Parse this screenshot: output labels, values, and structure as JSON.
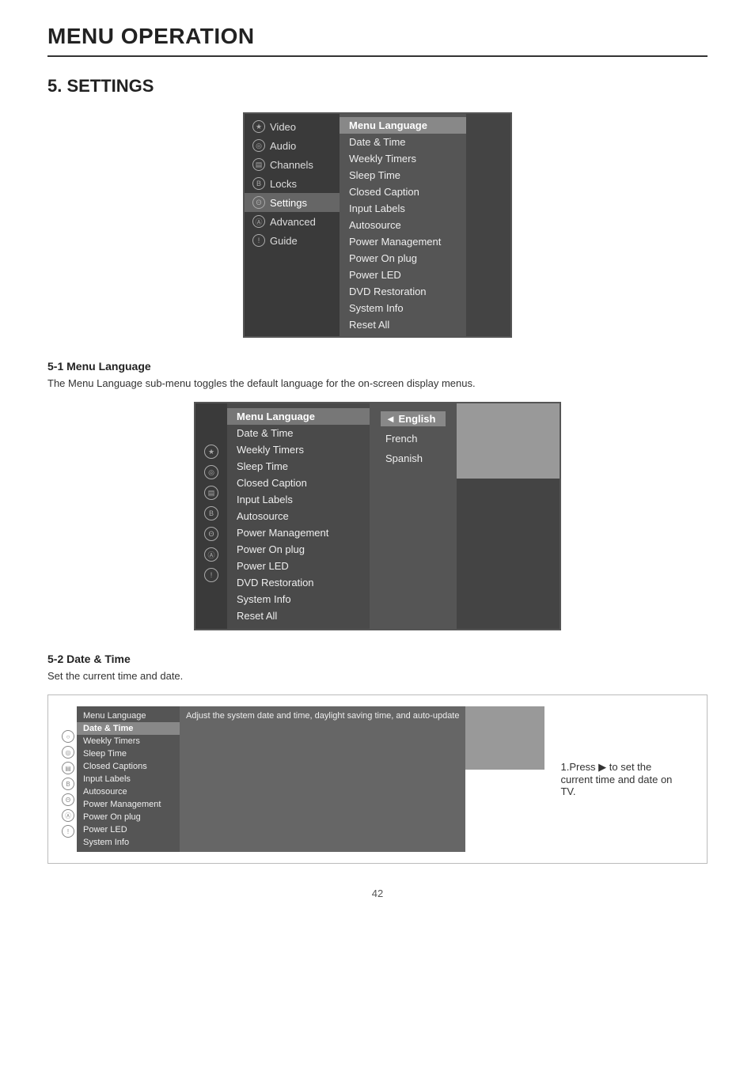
{
  "page": {
    "title": "MENU OPERATION",
    "page_number": "42"
  },
  "section": {
    "heading": "5. SETTINGS"
  },
  "main_menu": {
    "left_items": [
      {
        "icon": "★",
        "label": "Video",
        "selected": false
      },
      {
        "icon": "◎",
        "label": "Audio",
        "selected": false
      },
      {
        "icon": "▤",
        "label": "Channels",
        "selected": false
      },
      {
        "icon": "B",
        "label": "Locks",
        "selected": false
      },
      {
        "icon": "Θ",
        "label": "Settings",
        "selected": true
      },
      {
        "icon": "Ⓐ",
        "label": "Advanced",
        "selected": false
      },
      {
        "icon": "!",
        "label": "Guide",
        "selected": false
      }
    ],
    "right_items": [
      {
        "label": "Menu Language",
        "selected": true
      },
      {
        "label": "Date & Time",
        "selected": false
      },
      {
        "label": "Weekly Timers",
        "selected": false
      },
      {
        "label": "Sleep Time",
        "selected": false
      },
      {
        "label": "Closed Caption",
        "selected": false
      },
      {
        "label": "Input Labels",
        "selected": false
      },
      {
        "label": "Autosource",
        "selected": false
      },
      {
        "label": "Power Management",
        "selected": false
      },
      {
        "label": "Power On plug",
        "selected": false
      },
      {
        "label": "Power LED",
        "selected": false
      },
      {
        "label": "DVD Restoration",
        "selected": false
      },
      {
        "label": "System Info",
        "selected": false
      },
      {
        "label": "Reset All",
        "selected": false
      }
    ]
  },
  "subsection_51": {
    "heading": "5-1  Menu Language",
    "description": "The Menu Language sub-menu toggles the default language for the on-screen display menus."
  },
  "lang_menu": {
    "icons": [
      "★",
      "◎",
      "▤",
      "B",
      "Θ",
      "Ⓐ",
      "!"
    ],
    "mid_items": [
      {
        "label": "Menu Language",
        "selected": true
      },
      {
        "label": "Date & Time",
        "selected": false
      },
      {
        "label": "Weekly Timers",
        "selected": false
      },
      {
        "label": "Sleep Time",
        "selected": false
      },
      {
        "label": "Closed Caption",
        "selected": false
      },
      {
        "label": "Input Labels",
        "selected": false
      },
      {
        "label": "Autosource",
        "selected": false
      },
      {
        "label": "Power Management",
        "selected": false
      },
      {
        "label": "Power On plug",
        "selected": false
      },
      {
        "label": "Power LED",
        "selected": false
      },
      {
        "label": "DVD Restoration",
        "selected": false
      },
      {
        "label": "System Info",
        "selected": false
      },
      {
        "label": "Reset All",
        "selected": false
      }
    ],
    "lang_options": [
      {
        "label": "English",
        "selected": true
      },
      {
        "label": "French",
        "selected": false
      },
      {
        "label": "Spanish",
        "selected": false
      }
    ]
  },
  "subsection_52": {
    "heading": "5-2  Date & Time",
    "description": "Set the current time and date."
  },
  "date_time_menu": {
    "icons": [
      "○",
      "◎",
      "▤",
      "B",
      "Θ",
      "Ⓐ",
      "!"
    ],
    "left_items": [
      {
        "label": "Menu Language",
        "selected": false
      },
      {
        "label": "Date & Time",
        "selected": true
      },
      {
        "label": "Weekly Timers",
        "selected": false
      },
      {
        "label": "Sleep Time",
        "selected": false
      },
      {
        "label": "Closed Captions",
        "selected": false
      },
      {
        "label": "Input Labels",
        "selected": false
      },
      {
        "label": "Autosource",
        "selected": false
      },
      {
        "label": "Power Management",
        "selected": false
      },
      {
        "label": "Power On plug",
        "selected": false
      },
      {
        "label": "Power LED",
        "selected": false
      },
      {
        "label": "System Info",
        "selected": false
      }
    ],
    "mid_text": "Adjust the system date and time, daylight saving time, and auto-update",
    "instruction": "1.Press ▶ to set the current time and date on TV."
  }
}
